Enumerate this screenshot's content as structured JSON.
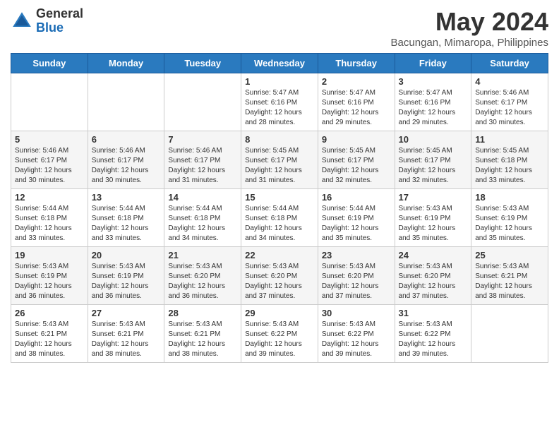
{
  "header": {
    "logo_general": "General",
    "logo_blue": "Blue",
    "title": "May 2024",
    "subtitle": "Bacungan, Mimaropa, Philippines"
  },
  "weekdays": [
    "Sunday",
    "Monday",
    "Tuesday",
    "Wednesday",
    "Thursday",
    "Friday",
    "Saturday"
  ],
  "weeks": [
    [
      {
        "day": "",
        "info": ""
      },
      {
        "day": "",
        "info": ""
      },
      {
        "day": "",
        "info": ""
      },
      {
        "day": "1",
        "info": "Sunrise: 5:47 AM\nSunset: 6:16 PM\nDaylight: 12 hours\nand 28 minutes."
      },
      {
        "day": "2",
        "info": "Sunrise: 5:47 AM\nSunset: 6:16 PM\nDaylight: 12 hours\nand 29 minutes."
      },
      {
        "day": "3",
        "info": "Sunrise: 5:47 AM\nSunset: 6:16 PM\nDaylight: 12 hours\nand 29 minutes."
      },
      {
        "day": "4",
        "info": "Sunrise: 5:46 AM\nSunset: 6:17 PM\nDaylight: 12 hours\nand 30 minutes."
      }
    ],
    [
      {
        "day": "5",
        "info": "Sunrise: 5:46 AM\nSunset: 6:17 PM\nDaylight: 12 hours\nand 30 minutes."
      },
      {
        "day": "6",
        "info": "Sunrise: 5:46 AM\nSunset: 6:17 PM\nDaylight: 12 hours\nand 30 minutes."
      },
      {
        "day": "7",
        "info": "Sunrise: 5:46 AM\nSunset: 6:17 PM\nDaylight: 12 hours\nand 31 minutes."
      },
      {
        "day": "8",
        "info": "Sunrise: 5:45 AM\nSunset: 6:17 PM\nDaylight: 12 hours\nand 31 minutes."
      },
      {
        "day": "9",
        "info": "Sunrise: 5:45 AM\nSunset: 6:17 PM\nDaylight: 12 hours\nand 32 minutes."
      },
      {
        "day": "10",
        "info": "Sunrise: 5:45 AM\nSunset: 6:17 PM\nDaylight: 12 hours\nand 32 minutes."
      },
      {
        "day": "11",
        "info": "Sunrise: 5:45 AM\nSunset: 6:18 PM\nDaylight: 12 hours\nand 33 minutes."
      }
    ],
    [
      {
        "day": "12",
        "info": "Sunrise: 5:44 AM\nSunset: 6:18 PM\nDaylight: 12 hours\nand 33 minutes."
      },
      {
        "day": "13",
        "info": "Sunrise: 5:44 AM\nSunset: 6:18 PM\nDaylight: 12 hours\nand 33 minutes."
      },
      {
        "day": "14",
        "info": "Sunrise: 5:44 AM\nSunset: 6:18 PM\nDaylight: 12 hours\nand 34 minutes."
      },
      {
        "day": "15",
        "info": "Sunrise: 5:44 AM\nSunset: 6:18 PM\nDaylight: 12 hours\nand 34 minutes."
      },
      {
        "day": "16",
        "info": "Sunrise: 5:44 AM\nSunset: 6:19 PM\nDaylight: 12 hours\nand 35 minutes."
      },
      {
        "day": "17",
        "info": "Sunrise: 5:43 AM\nSunset: 6:19 PM\nDaylight: 12 hours\nand 35 minutes."
      },
      {
        "day": "18",
        "info": "Sunrise: 5:43 AM\nSunset: 6:19 PM\nDaylight: 12 hours\nand 35 minutes."
      }
    ],
    [
      {
        "day": "19",
        "info": "Sunrise: 5:43 AM\nSunset: 6:19 PM\nDaylight: 12 hours\nand 36 minutes."
      },
      {
        "day": "20",
        "info": "Sunrise: 5:43 AM\nSunset: 6:19 PM\nDaylight: 12 hours\nand 36 minutes."
      },
      {
        "day": "21",
        "info": "Sunrise: 5:43 AM\nSunset: 6:20 PM\nDaylight: 12 hours\nand 36 minutes."
      },
      {
        "day": "22",
        "info": "Sunrise: 5:43 AM\nSunset: 6:20 PM\nDaylight: 12 hours\nand 37 minutes."
      },
      {
        "day": "23",
        "info": "Sunrise: 5:43 AM\nSunset: 6:20 PM\nDaylight: 12 hours\nand 37 minutes."
      },
      {
        "day": "24",
        "info": "Sunrise: 5:43 AM\nSunset: 6:20 PM\nDaylight: 12 hours\nand 37 minutes."
      },
      {
        "day": "25",
        "info": "Sunrise: 5:43 AM\nSunset: 6:21 PM\nDaylight: 12 hours\nand 38 minutes."
      }
    ],
    [
      {
        "day": "26",
        "info": "Sunrise: 5:43 AM\nSunset: 6:21 PM\nDaylight: 12 hours\nand 38 minutes."
      },
      {
        "day": "27",
        "info": "Sunrise: 5:43 AM\nSunset: 6:21 PM\nDaylight: 12 hours\nand 38 minutes."
      },
      {
        "day": "28",
        "info": "Sunrise: 5:43 AM\nSunset: 6:21 PM\nDaylight: 12 hours\nand 38 minutes."
      },
      {
        "day": "29",
        "info": "Sunrise: 5:43 AM\nSunset: 6:22 PM\nDaylight: 12 hours\nand 39 minutes."
      },
      {
        "day": "30",
        "info": "Sunrise: 5:43 AM\nSunset: 6:22 PM\nDaylight: 12 hours\nand 39 minutes."
      },
      {
        "day": "31",
        "info": "Sunrise: 5:43 AM\nSunset: 6:22 PM\nDaylight: 12 hours\nand 39 minutes."
      },
      {
        "day": "",
        "info": ""
      }
    ]
  ]
}
